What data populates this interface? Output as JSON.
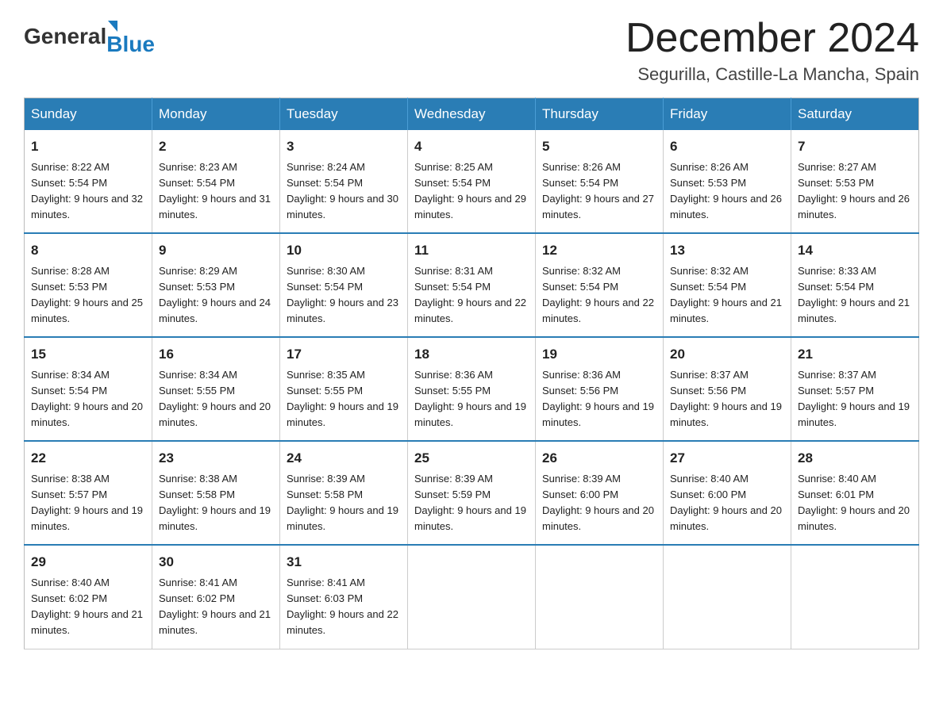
{
  "header": {
    "logo_general": "General",
    "logo_blue": "Blue",
    "month_title": "December 2024",
    "location": "Segurilla, Castille-La Mancha, Spain"
  },
  "days_of_week": [
    "Sunday",
    "Monday",
    "Tuesday",
    "Wednesday",
    "Thursday",
    "Friday",
    "Saturday"
  ],
  "weeks": [
    [
      {
        "day": "1",
        "sunrise": "8:22 AM",
        "sunset": "5:54 PM",
        "daylight": "9 hours and 32 minutes."
      },
      {
        "day": "2",
        "sunrise": "8:23 AM",
        "sunset": "5:54 PM",
        "daylight": "9 hours and 31 minutes."
      },
      {
        "day": "3",
        "sunrise": "8:24 AM",
        "sunset": "5:54 PM",
        "daylight": "9 hours and 30 minutes."
      },
      {
        "day": "4",
        "sunrise": "8:25 AM",
        "sunset": "5:54 PM",
        "daylight": "9 hours and 29 minutes."
      },
      {
        "day": "5",
        "sunrise": "8:26 AM",
        "sunset": "5:54 PM",
        "daylight": "9 hours and 27 minutes."
      },
      {
        "day": "6",
        "sunrise": "8:26 AM",
        "sunset": "5:53 PM",
        "daylight": "9 hours and 26 minutes."
      },
      {
        "day": "7",
        "sunrise": "8:27 AM",
        "sunset": "5:53 PM",
        "daylight": "9 hours and 26 minutes."
      }
    ],
    [
      {
        "day": "8",
        "sunrise": "8:28 AM",
        "sunset": "5:53 PM",
        "daylight": "9 hours and 25 minutes."
      },
      {
        "day": "9",
        "sunrise": "8:29 AM",
        "sunset": "5:53 PM",
        "daylight": "9 hours and 24 minutes."
      },
      {
        "day": "10",
        "sunrise": "8:30 AM",
        "sunset": "5:54 PM",
        "daylight": "9 hours and 23 minutes."
      },
      {
        "day": "11",
        "sunrise": "8:31 AM",
        "sunset": "5:54 PM",
        "daylight": "9 hours and 22 minutes."
      },
      {
        "day": "12",
        "sunrise": "8:32 AM",
        "sunset": "5:54 PM",
        "daylight": "9 hours and 22 minutes."
      },
      {
        "day": "13",
        "sunrise": "8:32 AM",
        "sunset": "5:54 PM",
        "daylight": "9 hours and 21 minutes."
      },
      {
        "day": "14",
        "sunrise": "8:33 AM",
        "sunset": "5:54 PM",
        "daylight": "9 hours and 21 minutes."
      }
    ],
    [
      {
        "day": "15",
        "sunrise": "8:34 AM",
        "sunset": "5:54 PM",
        "daylight": "9 hours and 20 minutes."
      },
      {
        "day": "16",
        "sunrise": "8:34 AM",
        "sunset": "5:55 PM",
        "daylight": "9 hours and 20 minutes."
      },
      {
        "day": "17",
        "sunrise": "8:35 AM",
        "sunset": "5:55 PM",
        "daylight": "9 hours and 19 minutes."
      },
      {
        "day": "18",
        "sunrise": "8:36 AM",
        "sunset": "5:55 PM",
        "daylight": "9 hours and 19 minutes."
      },
      {
        "day": "19",
        "sunrise": "8:36 AM",
        "sunset": "5:56 PM",
        "daylight": "9 hours and 19 minutes."
      },
      {
        "day": "20",
        "sunrise": "8:37 AM",
        "sunset": "5:56 PM",
        "daylight": "9 hours and 19 minutes."
      },
      {
        "day": "21",
        "sunrise": "8:37 AM",
        "sunset": "5:57 PM",
        "daylight": "9 hours and 19 minutes."
      }
    ],
    [
      {
        "day": "22",
        "sunrise": "8:38 AM",
        "sunset": "5:57 PM",
        "daylight": "9 hours and 19 minutes."
      },
      {
        "day": "23",
        "sunrise": "8:38 AM",
        "sunset": "5:58 PM",
        "daylight": "9 hours and 19 minutes."
      },
      {
        "day": "24",
        "sunrise": "8:39 AM",
        "sunset": "5:58 PM",
        "daylight": "9 hours and 19 minutes."
      },
      {
        "day": "25",
        "sunrise": "8:39 AM",
        "sunset": "5:59 PM",
        "daylight": "9 hours and 19 minutes."
      },
      {
        "day": "26",
        "sunrise": "8:39 AM",
        "sunset": "6:00 PM",
        "daylight": "9 hours and 20 minutes."
      },
      {
        "day": "27",
        "sunrise": "8:40 AM",
        "sunset": "6:00 PM",
        "daylight": "9 hours and 20 minutes."
      },
      {
        "day": "28",
        "sunrise": "8:40 AM",
        "sunset": "6:01 PM",
        "daylight": "9 hours and 20 minutes."
      }
    ],
    [
      {
        "day": "29",
        "sunrise": "8:40 AM",
        "sunset": "6:02 PM",
        "daylight": "9 hours and 21 minutes."
      },
      {
        "day": "30",
        "sunrise": "8:41 AM",
        "sunset": "6:02 PM",
        "daylight": "9 hours and 21 minutes."
      },
      {
        "day": "31",
        "sunrise": "8:41 AM",
        "sunset": "6:03 PM",
        "daylight": "9 hours and 22 minutes."
      },
      null,
      null,
      null,
      null
    ]
  ]
}
